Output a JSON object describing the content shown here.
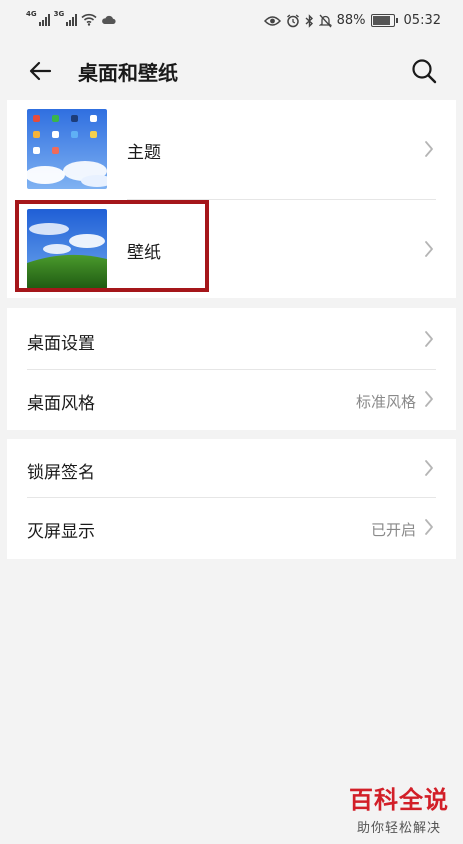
{
  "status_bar": {
    "net1": "4G",
    "net2": "3G",
    "battery": "88%",
    "battery_level": 0.88,
    "time": "05:32",
    "icons": [
      "signal-icon",
      "wifi-icon",
      "cloud-icon",
      "eye-icon",
      "alarm-icon",
      "bluetooth-icon",
      "mute-icon",
      "battery-icon"
    ]
  },
  "header": {
    "title": "桌面和壁纸",
    "back_icon": "back-arrow-icon",
    "search_icon": "search-icon"
  },
  "group1": {
    "items": [
      {
        "label": "主题",
        "thumb": "theme-thumbnail"
      },
      {
        "label": "壁纸",
        "thumb": "wallpaper-thumbnail"
      }
    ]
  },
  "group2": {
    "items": [
      {
        "label": "桌面设置",
        "value": ""
      },
      {
        "label": "桌面风格",
        "value": "标准风格"
      }
    ]
  },
  "group3": {
    "items": [
      {
        "label": "锁屏签名",
        "value": ""
      },
      {
        "label": "灭屏显示",
        "value": "已开启"
      }
    ]
  },
  "watermark": {
    "title": "百科全说",
    "subtitle": "助你轻松解决"
  },
  "colors": {
    "background": "#f3f3f3",
    "card": "#ffffff",
    "highlight": "#a5161a",
    "watermark": "#d21f28"
  }
}
